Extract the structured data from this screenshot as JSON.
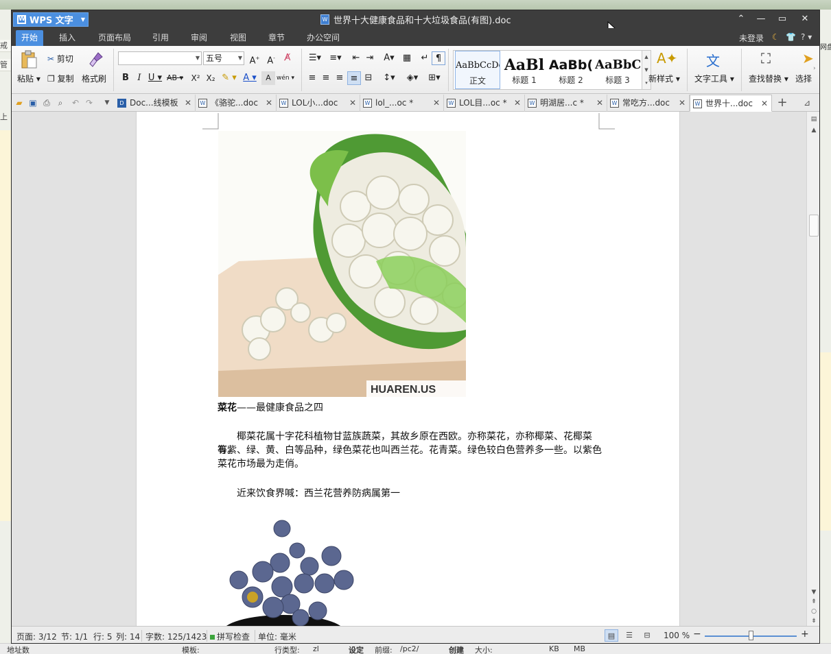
{
  "background": {
    "left_strip_texts": [
      "戒",
      "管",
      "上传"
    ],
    "right_strip_texts": [
      "网盘"
    ],
    "bottom_labels": [
      "地址数",
      "模板:",
      "行类型:",
      "zl",
      "设定",
      "前缀:",
      "/pc2/",
      "创建",
      "大小:",
      "KB",
      "MB"
    ]
  },
  "window": {
    "app_name": "WPS 文字",
    "document_title": "世界十大健康食品和十大垃圾食品(有图).doc"
  },
  "menu": {
    "tabs": [
      "开始",
      "插入",
      "页面布局",
      "引用",
      "审阅",
      "视图",
      "章节",
      "办公空间"
    ],
    "active_tab": "开始",
    "login": "未登录",
    "help": "?"
  },
  "ribbon": {
    "paste": "粘贴",
    "cut": "剪切",
    "copy": "复制",
    "format_painter": "格式刷",
    "font_name": "",
    "font_size": "五号",
    "styles": [
      {
        "sample": "AaBbCcDd",
        "label": "正文"
      },
      {
        "sample": "AaBl",
        "label": "标题 1"
      },
      {
        "sample": "AaBb(",
        "label": "标题 2"
      },
      {
        "sample": "AaBbC",
        "label": "标题 3"
      }
    ],
    "new_style": "新样式",
    "text_tools": "文字工具",
    "find_replace": "查找替换",
    "select": "选择"
  },
  "doc_tabs": [
    {
      "title": "Doc...线模板",
      "active": false
    },
    {
      "title": "《骆驼...doc",
      "active": false
    },
    {
      "title": "LOL小...doc",
      "active": false
    },
    {
      "title": "lol_...oc *",
      "active": false
    },
    {
      "title": "LOL目...oc *",
      "active": false
    },
    {
      "title": "明湖居...c *",
      "active": false
    },
    {
      "title": "常吃方...doc",
      "active": false
    },
    {
      "title": "世界十...doc",
      "active": true
    }
  ],
  "document": {
    "image_watermark": "HUAREN.US",
    "heading_bold": "菜花",
    "heading_rest": "——最健康食品之四",
    "paragraph1_line1": "椰菜花属十字花科植物甘蓝族蔬菜，其故乡原在西欧。亦称菜花，亦称椰菜、花椰菜等。",
    "paragraph1_line2": "有紫、绿、黄、白等品种，绿色菜花也叫西兰花。花青菜。绿色较白色营养多一些。以紫色",
    "paragraph1_line3": "菜花市场最为走俏。",
    "paragraph2": "近来饮食界喊：西兰花营养防病属第一"
  },
  "status": {
    "page": "页面: 3/12",
    "section": "节: 1/1",
    "row": "行: 5",
    "column": "列: 14",
    "word_count": "字数: 125/1423",
    "spell_check": "拼写检查",
    "unit": "单位: 毫米",
    "zoom": "100 %",
    "zoom_level_percent": 100
  },
  "colors": {
    "titlebar": "#3d3d3d",
    "accent": "#4b8fe0",
    "page": "#ffffff"
  }
}
